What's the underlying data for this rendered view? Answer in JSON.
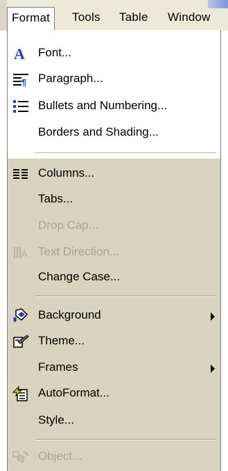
{
  "menubar": {
    "items": [
      "Format",
      "Tools",
      "Table",
      "Window"
    ]
  },
  "menu": {
    "items": [
      {
        "label": "Font...",
        "icon": "font-icon",
        "enabled": true
      },
      {
        "label": "Paragraph...",
        "icon": "paragraph-icon",
        "enabled": true
      },
      {
        "label": "Bullets and Numbering...",
        "icon": "bullets-icon",
        "enabled": true
      },
      {
        "label": "Borders and Shading...",
        "icon": "",
        "enabled": true
      },
      {
        "label": "Columns...",
        "icon": "columns-icon",
        "enabled": true
      },
      {
        "label": "Tabs...",
        "icon": "",
        "enabled": true
      },
      {
        "label": "Drop Cap...",
        "icon": "",
        "enabled": false
      },
      {
        "label": "Text Direction...",
        "icon": "text-direction-icon",
        "enabled": false
      },
      {
        "label": "Change Case...",
        "icon": "",
        "enabled": true
      },
      {
        "label": "Background",
        "icon": "background-icon",
        "enabled": true,
        "submenu": true
      },
      {
        "label": "Theme...",
        "icon": "theme-icon",
        "enabled": true
      },
      {
        "label": "Frames",
        "icon": "",
        "enabled": true,
        "submenu": true
      },
      {
        "label": "AutoFormat...",
        "icon": "autoformat-icon",
        "enabled": true
      },
      {
        "label": "Style...",
        "icon": "",
        "enabled": true
      },
      {
        "label": "Object...",
        "icon": "object-icon",
        "enabled": false
      }
    ]
  },
  "colors": {
    "menu_bg": "#d8d3bd",
    "upper_bg": "#ffffff",
    "disabled_text": "#a8a596",
    "accent_blue": "#1c3fd6"
  }
}
